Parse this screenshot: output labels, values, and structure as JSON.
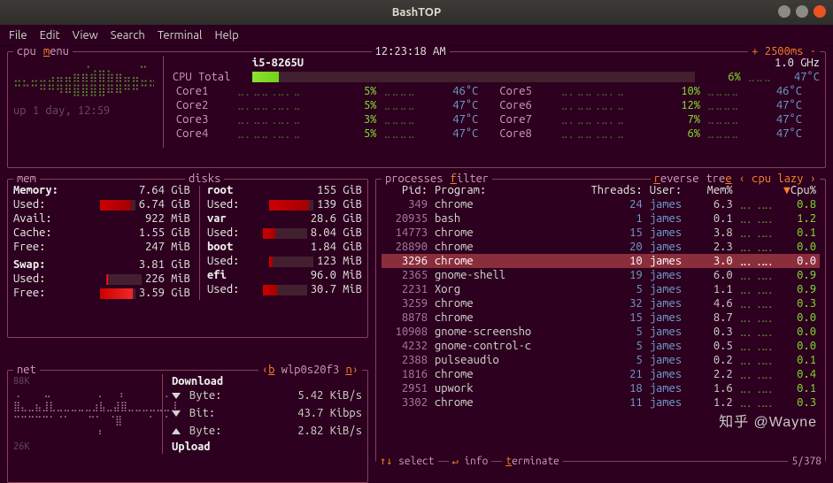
{
  "window": {
    "title": "BashTOP"
  },
  "menubar": [
    "File",
    "Edit",
    "View",
    "Search",
    "Terminal",
    "Help"
  ],
  "top": {
    "cpu_label": "cpu",
    "menu_key": "m",
    "menu_rest": "enu",
    "clock": "12:23:18 AM",
    "interval": "+ 2500ms -",
    "freq": "1.0 GHz",
    "model": "i5-8265U",
    "uptime": "up 1 day, 12:59",
    "total_label": "CPU Total",
    "total_pct": "6%",
    "total_temp": "47°C",
    "cores": [
      {
        "name": "Core1",
        "pct": "5%",
        "temp": "46°C"
      },
      {
        "name": "Core2",
        "pct": "5%",
        "temp": "47°C"
      },
      {
        "name": "Core3",
        "pct": "3%",
        "temp": "47°C"
      },
      {
        "name": "Core4",
        "pct": "5%",
        "temp": "47°C"
      },
      {
        "name": "Core5",
        "pct": "10%",
        "temp": "46°C"
      },
      {
        "name": "Core6",
        "pct": "12%",
        "temp": "47°C"
      },
      {
        "name": "Core7",
        "pct": "7%",
        "temp": "47°C"
      },
      {
        "name": "Core8",
        "pct": "6%",
        "temp": "47°C"
      }
    ]
  },
  "mem": {
    "title": "mem",
    "memory_label": "Memory:",
    "memory_total": "7.64 GiB",
    "rows": [
      {
        "lbl": "Used:",
        "val": "6.74 GiB",
        "fill": 0.88,
        "cls": "mem"
      },
      {
        "lbl": "Avail:",
        "val": "922 MiB"
      },
      {
        "lbl": "Cache:",
        "val": "1.55 GiB"
      },
      {
        "lbl": "Free:",
        "val": "247 MiB"
      }
    ],
    "swap_label": "Swap:",
    "swap_total": "3.81 GiB",
    "swap_rows": [
      {
        "lbl": "Used:",
        "val": "226 MiB",
        "fill": 0.06,
        "cls": "swap"
      },
      {
        "lbl": "Free:",
        "val": "3.59 GiB",
        "fill": 0.94,
        "cls": ""
      }
    ]
  },
  "disks": {
    "title": "disks",
    "items": [
      {
        "name": "root",
        "total": "155 GiB",
        "used_lbl": "Used:",
        "used": "139 GiB",
        "fill": 0.9
      },
      {
        "name": "var",
        "total": "28.6 GiB",
        "used_lbl": "Used:",
        "used": "8.04 GiB",
        "fill": 0.28
      },
      {
        "name": "boot",
        "total": "1.84 GiB",
        "used_lbl": "Used:",
        "used": "123 MiB",
        "fill": 0.07
      },
      {
        "name": "efi",
        "total": "96.0 MiB",
        "used_lbl": "Used:",
        "used": "30.7 MiB",
        "fill": 0.32
      }
    ]
  },
  "net": {
    "title": "net",
    "iface_b": "b",
    "iface": "wlp0s20f3",
    "iface_n": "n",
    "top_scale": "88K",
    "bot_scale": "26K",
    "download_label": "Download",
    "upload_label": "Upload",
    "rows": [
      {
        "dir": "down",
        "lbl": "Byte:",
        "val": "5.42 KiB/s"
      },
      {
        "dir": "down",
        "lbl": "Bit:",
        "val": "43.7 Kibps"
      },
      {
        "dir": "up",
        "lbl": "Byte:",
        "val": "2.82 KiB/s"
      }
    ]
  },
  "proc": {
    "title": "processes",
    "filter_key": "f",
    "filter_rest": "ilter",
    "reverse_key": "r",
    "reverse_rest": "everse",
    "tree_rest": "tre",
    "tree_key": "e",
    "sort": "‹ cpu lazy ›",
    "headers": {
      "pid": "Pid:",
      "prog": "Program:",
      "thr": "Threads:",
      "usr": "User:",
      "mem": "Mem%",
      "cpu": "Cpu%"
    },
    "selected_pid": 3296,
    "counter": "5/378",
    "rows": [
      {
        "pid": 349,
        "prog": "chrome",
        "thr": 24,
        "usr": "james",
        "mem": "6.3",
        "cpu": "0.8"
      },
      {
        "pid": 20935,
        "prog": "bash",
        "thr": 1,
        "usr": "james",
        "mem": "0.1",
        "cpu": "1.2"
      },
      {
        "pid": 14773,
        "prog": "chrome",
        "thr": 15,
        "usr": "james",
        "mem": "3.8",
        "cpu": "0.1"
      },
      {
        "pid": 28890,
        "prog": "chrome",
        "thr": 20,
        "usr": "james",
        "mem": "2.3",
        "cpu": "0.0"
      },
      {
        "pid": 3296,
        "prog": "chrome",
        "thr": 10,
        "usr": "james",
        "mem": "3.0",
        "cpu": "0.0"
      },
      {
        "pid": 2365,
        "prog": "gnome-shell",
        "thr": 19,
        "usr": "james",
        "mem": "6.0",
        "cpu": "0.9"
      },
      {
        "pid": 2231,
        "prog": "Xorg",
        "thr": 5,
        "usr": "james",
        "mem": "1.1",
        "cpu": "0.9"
      },
      {
        "pid": 3259,
        "prog": "chrome",
        "thr": 32,
        "usr": "james",
        "mem": "4.6",
        "cpu": "0.3"
      },
      {
        "pid": 8878,
        "prog": "chrome",
        "thr": 15,
        "usr": "james",
        "mem": "8.7",
        "cpu": "0.0"
      },
      {
        "pid": 10908,
        "prog": "gnome-screensho",
        "thr": 5,
        "usr": "james",
        "mem": "0.3",
        "cpu": "0.0"
      },
      {
        "pid": 4232,
        "prog": "gnome-control-c",
        "thr": 5,
        "usr": "james",
        "mem": "0.5",
        "cpu": "0.0"
      },
      {
        "pid": 2388,
        "prog": "pulseaudio",
        "thr": 5,
        "usr": "james",
        "mem": "0.2",
        "cpu": "0.1"
      },
      {
        "pid": 1816,
        "prog": "chrome",
        "thr": 21,
        "usr": "james",
        "mem": "2.2",
        "cpu": "0.4"
      },
      {
        "pid": 2951,
        "prog": "upwork",
        "thr": 18,
        "usr": "james",
        "mem": "1.6",
        "cpu": "0.1"
      },
      {
        "pid": 3302,
        "prog": "chrome",
        "thr": 11,
        "usr": "james",
        "mem": "1.2",
        "cpu": "0.3"
      }
    ],
    "footer": [
      {
        "arrow": "↑↓",
        "key": "",
        "rest": "select"
      },
      {
        "arrow": "↵",
        "key": "",
        "rest": "info"
      },
      {
        "arrow": "",
        "key": "t",
        "rest": "erminate"
      }
    ]
  },
  "watermark": "知乎 @Wayne"
}
